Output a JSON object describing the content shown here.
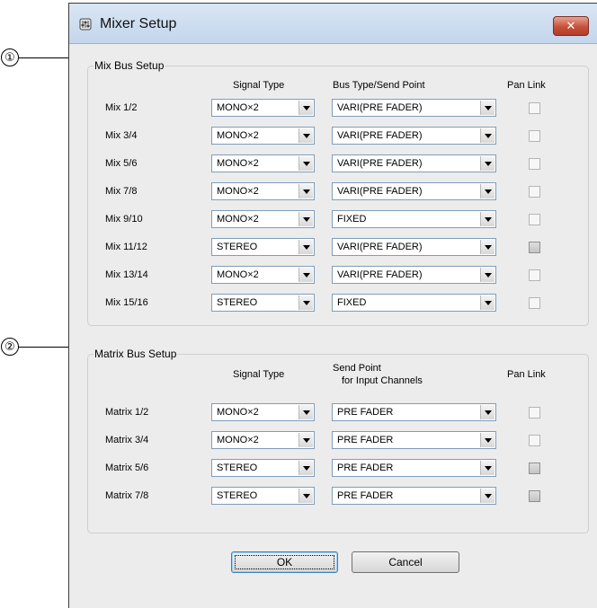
{
  "callouts": {
    "mix": "①",
    "matrix": "②"
  },
  "window": {
    "title": "Mixer Setup",
    "close_glyph": "✕",
    "icon": "mixer-app-icon"
  },
  "mix_bus": {
    "legend": "Mix Bus Setup",
    "headers": {
      "signal_type": "Signal Type",
      "bus_type": "Bus Type/Send Point",
      "pan_link": "Pan Link"
    },
    "rows": [
      {
        "label": "Mix 1/2",
        "signal": "MONO×2",
        "bus": "VARI(PRE FADER)",
        "pan_link": false
      },
      {
        "label": "Mix 3/4",
        "signal": "MONO×2",
        "bus": "VARI(PRE FADER)",
        "pan_link": false
      },
      {
        "label": "Mix 5/6",
        "signal": "MONO×2",
        "bus": "VARI(PRE FADER)",
        "pan_link": false
      },
      {
        "label": "Mix 7/8",
        "signal": "MONO×2",
        "bus": "VARI(PRE FADER)",
        "pan_link": false
      },
      {
        "label": "Mix 9/10",
        "signal": "MONO×2",
        "bus": "FIXED",
        "pan_link": false
      },
      {
        "label": "Mix 11/12",
        "signal": "STEREO",
        "bus": "VARI(PRE FADER)",
        "pan_link": true
      },
      {
        "label": "Mix 13/14",
        "signal": "MONO×2",
        "bus": "VARI(PRE FADER)",
        "pan_link": false
      },
      {
        "label": "Mix 15/16",
        "signal": "STEREO",
        "bus": "FIXED",
        "pan_link": false
      }
    ]
  },
  "matrix_bus": {
    "legend": "Matrix Bus Setup",
    "headers": {
      "signal_type": "Signal Type",
      "send_point_line1": "Send Point",
      "send_point_line2": "for Input Channels",
      "pan_link": "Pan Link"
    },
    "rows": [
      {
        "label": "Matrix 1/2",
        "signal": "MONO×2",
        "send": "PRE FADER",
        "pan_link": false
      },
      {
        "label": "Matrix 3/4",
        "signal": "MONO×2",
        "send": "PRE FADER",
        "pan_link": false
      },
      {
        "label": "Matrix 5/6",
        "signal": "STEREO",
        "send": "PRE FADER",
        "pan_link": true
      },
      {
        "label": "Matrix 7/8",
        "signal": "STEREO",
        "send": "PRE FADER",
        "pan_link": true
      }
    ]
  },
  "buttons": {
    "ok": "OK",
    "cancel": "Cancel"
  }
}
